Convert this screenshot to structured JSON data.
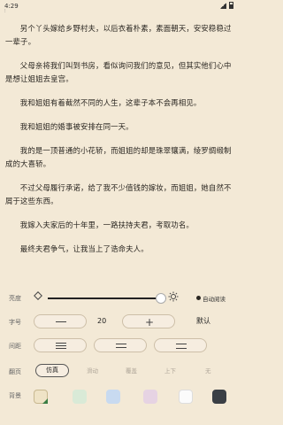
{
  "status": {
    "time": "4:29",
    "mini": "⁝"
  },
  "reader": {
    "paragraphs": [
      "另个丫头嫁给乡野村夫，以后衣着朴素，素面朝天，安安稳稳过一辈子。",
      "父母亲将我们叫到书房，看似询问我们的意见，但其实他们心中是想让姐姐去皇宫。",
      "我和姐姐有着截然不同的人生，这辈子本不会再相见。",
      "我和姐姐的婚事被安排在同一天。",
      "我的是一顶普通的小花轿，而姐姐的却是珠翠镶满，绫罗绸缎制成的大喜轿。",
      "不过父母履行承诺，给了我不少值钱的嫁妆，而姐姐，她自然不屑于这些东西。",
      "我嫁入夫家后的十年里，一路扶持夫君，考取功名。",
      "最终夫君争气，让我当上了诰命夫人。"
    ]
  },
  "settings": {
    "brightness": {
      "label": "亮度",
      "level_percent": 100,
      "auto_label": "自动阅读"
    },
    "font_size": {
      "label": "字号",
      "value": "20",
      "default_label": "默认"
    },
    "spacing": {
      "label": "间距"
    },
    "page_turn": {
      "label": "翻页",
      "options": [
        "仿真",
        "滑动",
        "覆盖",
        "上下",
        "无"
      ],
      "selected": "仿真"
    },
    "background": {
      "label": "背景",
      "swatches": [
        "#efe3c6",
        "#d9ead7",
        "#c8daf0",
        "#e6d3e3",
        "#fbfbfb",
        "#3a3f45"
      ],
      "selected_index": 0
    }
  },
  "colors": {
    "page_bg": "#f3e9d6",
    "text": "#2a2621",
    "accent": "#3a7d44"
  }
}
